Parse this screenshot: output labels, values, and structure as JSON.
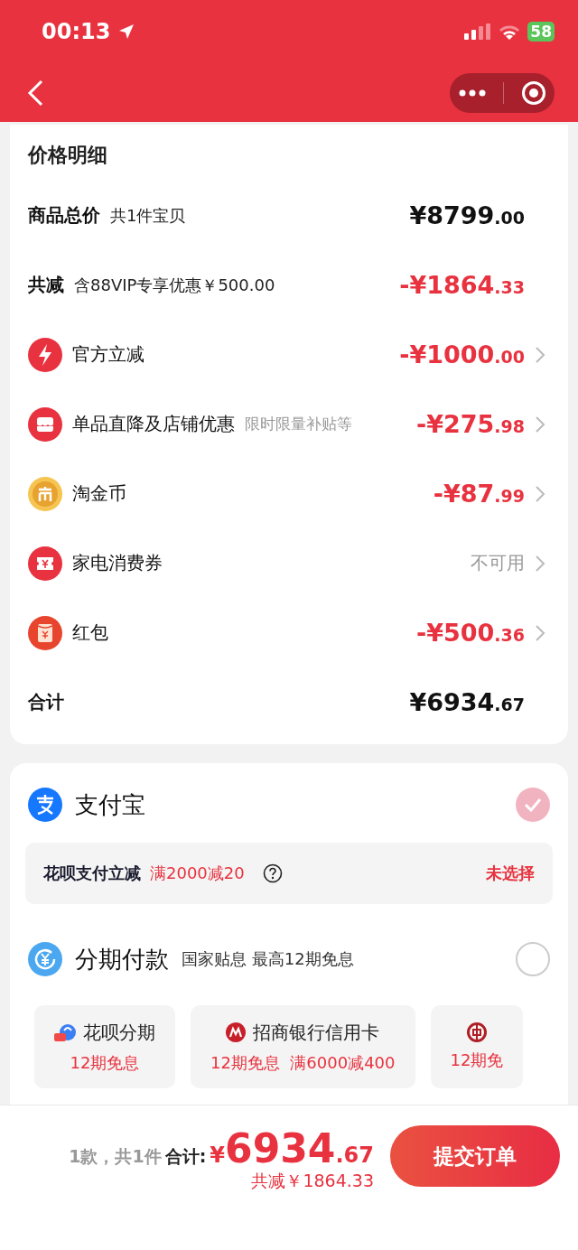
{
  "status_bar": {
    "time": "00:13",
    "battery": "58"
  },
  "price_details": {
    "title": "价格明细",
    "rows": [
      {
        "kind": "plain",
        "label": "商品总价",
        "note": "共1件宝贝",
        "amount": "¥8799",
        "cents": ".00",
        "color": "#111111",
        "chevron": false
      },
      {
        "kind": "plain",
        "label": "共减",
        "note": "含88VIP专享优惠￥500.00",
        "amount": "-¥1864",
        "cents": ".33",
        "color": "#e8323f",
        "chevron": false
      },
      {
        "kind": "bolt",
        "label": "官方立减",
        "amount": "-¥1000",
        "cents": ".00",
        "color": "#e8323f",
        "chevron": true
      },
      {
        "kind": "shop",
        "label": "单品直降及店铺优惠",
        "note": "限时限量补贴等",
        "amount": "-¥275",
        "cents": ".98",
        "color": "#e8323f",
        "chevron": true
      },
      {
        "kind": "coin",
        "label": "淘金币",
        "amount": "-¥87",
        "cents": ".99",
        "color": "#e8323f",
        "chevron": true
      },
      {
        "kind": "ticket",
        "label": "家电消费券",
        "status": "不可用",
        "color": "#999999",
        "chevron": true
      },
      {
        "kind": "envelope",
        "label": "红包",
        "amount": "-¥500",
        "cents": ".36",
        "color": "#e8323f",
        "chevron": true
      },
      {
        "kind": "plain",
        "label": "合计",
        "amount": "¥6934",
        "cents": ".67",
        "color": "#111111",
        "chevron": false
      }
    ]
  },
  "payment": {
    "alipay": {
      "label": "支付宝",
      "selected": true
    },
    "promo": {
      "label": "花呗支付立减",
      "offer": "满2000减20",
      "action": "未选择"
    },
    "installment": {
      "label": "分期付款",
      "note": "国家贴息 最高12期免息",
      "selected": false,
      "options": [
        {
          "kind": "huabei",
          "title": "花呗分期",
          "offer": "12期免息"
        },
        {
          "kind": "bank",
          "title": "招商银行信用卡",
          "offer": "12期免息  满6000减400"
        },
        {
          "kind": "coinbank",
          "offer": "12期免"
        }
      ]
    }
  },
  "bottom_bar": {
    "count": "1款，共1件",
    "total_label": "合计:",
    "currency": "¥",
    "total": "6934",
    "total_cents": ".67",
    "saved": "共减￥1864.33",
    "submit": "提交订单"
  }
}
